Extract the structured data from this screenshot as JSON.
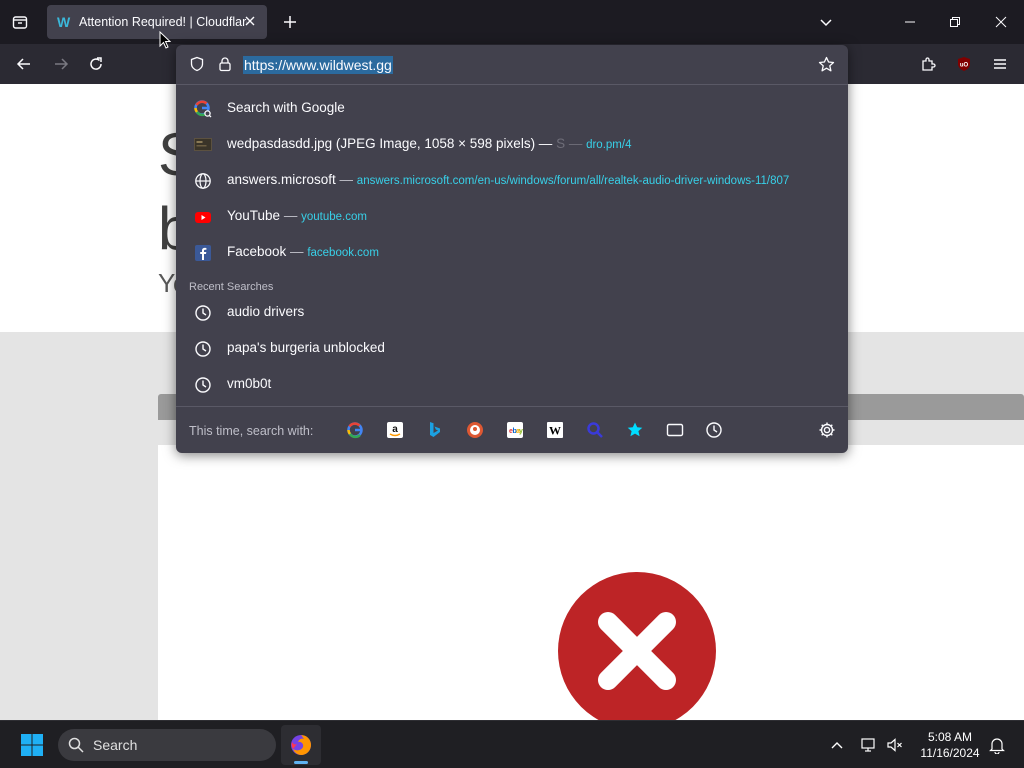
{
  "browser": {
    "tab": {
      "favicon_letter": "W",
      "title": "Attention Required! | Cloudflare"
    },
    "urlbar": {
      "value": "https://www.wildwest.gg"
    }
  },
  "page": {
    "heading_fragment_1": "S",
    "heading_fragment_2": "b",
    "subtext_fragment": "Yo"
  },
  "dropdown": {
    "results": [
      {
        "kind": "search",
        "icon": "google-search-icon",
        "label": "Search with Google",
        "sep": "",
        "url": ""
      },
      {
        "kind": "image",
        "icon": "image-thumbnail-icon",
        "label": "wedpasdasdd.jpg (JPEG Image, 1058 × 598 pixels) — ",
        "sep": "S — ",
        "url": "dro.pm/4"
      },
      {
        "kind": "history",
        "icon": "globe-icon",
        "label": "answers.microsoft",
        "sep": " — ",
        "url": "answers.microsoft.com/en-us/windows/forum/all/realtek-audio-driver-windows-11/807"
      },
      {
        "kind": "bookmark",
        "icon": "youtube-icon",
        "label": "YouTube",
        "sep": " — ",
        "url": "youtube.com"
      },
      {
        "kind": "bookmark",
        "icon": "facebook-icon",
        "label": "Facebook",
        "sep": " — ",
        "url": "facebook.com"
      }
    ],
    "recent_header": "Recent Searches",
    "recent": [
      {
        "icon": "clock-icon",
        "label": "audio drivers"
      },
      {
        "icon": "clock-icon",
        "label": "papa's burgeria unblocked"
      },
      {
        "icon": "clock-icon",
        "label": "vm0b0t"
      }
    ],
    "one_time_label": "This time, search with:",
    "engines": [
      {
        "name": "google-engine-icon"
      },
      {
        "name": "amazon-engine-icon"
      },
      {
        "name": "bing-engine-icon"
      },
      {
        "name": "duckduckgo-engine-icon"
      },
      {
        "name": "ebay-engine-icon"
      },
      {
        "name": "wikipedia-engine-icon"
      },
      {
        "name": "other-search-engine-icon"
      },
      {
        "name": "bookmarks-search-icon"
      },
      {
        "name": "tabs-search-icon"
      },
      {
        "name": "history-search-icon"
      }
    ]
  },
  "taskbar": {
    "search_label": "Search",
    "time": "5:08 AM",
    "date": "11/16/2024"
  },
  "colors": {
    "accent": "#00ddff",
    "error_red": "#bd2426"
  }
}
